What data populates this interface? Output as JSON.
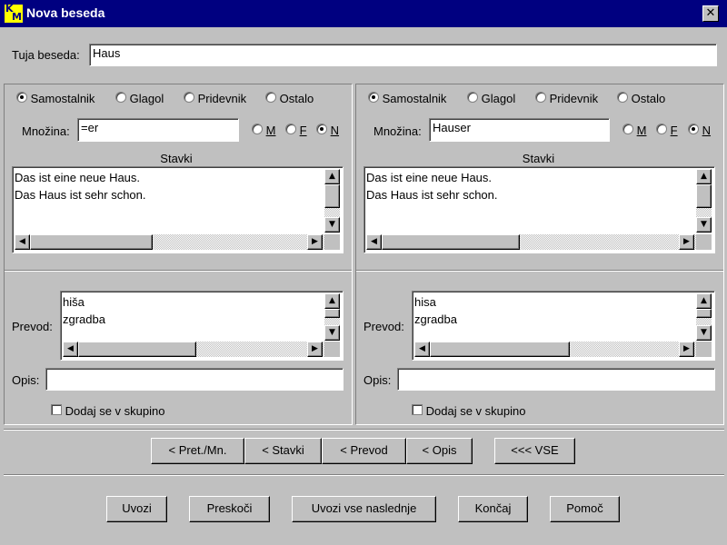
{
  "window": {
    "title": "Nova beseda",
    "close": "✕"
  },
  "foreign": {
    "label": "Tuja beseda:",
    "value": "Haus"
  },
  "word_types": [
    "Samostalnik",
    "Glagol",
    "Pridevnik",
    "Ostalo"
  ],
  "genders": [
    "M",
    "F",
    "N"
  ],
  "left": {
    "plural_label": "Množina:",
    "plural_value": "=er",
    "sentences_label": "Stavki",
    "sentences": "Das ist eine neue Haus.\nDas Haus ist sehr schon.",
    "translation_label": "Prevod:",
    "translations": "hiša\nzgradba",
    "desc_label": "Opis:",
    "desc_value": "",
    "group_label": "Dodaj se v skupino"
  },
  "right": {
    "plural_label": "Množina:",
    "plural_value": "Hauser",
    "sentences_label": "Stavki",
    "sentences": "Das ist eine neue Haus.\nDas Haus ist sehr schon.",
    "translation_label": "Prevod:",
    "translations": "hisa\nzgradba",
    "desc_label": "Opis:",
    "desc_value": "",
    "group_label": "Dodaj se v skupino"
  },
  "copy_buttons": {
    "pret": "< Pret./Mn.",
    "stavki": "< Stavki",
    "prevod": "< Prevod",
    "opis": "< Opis",
    "vse": "<<< VSE"
  },
  "footer": {
    "uvozi": "Uvozi",
    "preskoci": "Preskoči",
    "uvozi_vse": "Uvozi vse naslednje",
    "koncaj": "Končaj",
    "pomoc": "Pomoč"
  },
  "scroll_glyphs": {
    "up": "▲",
    "down": "▼",
    "left": "◀",
    "right": "▶"
  }
}
